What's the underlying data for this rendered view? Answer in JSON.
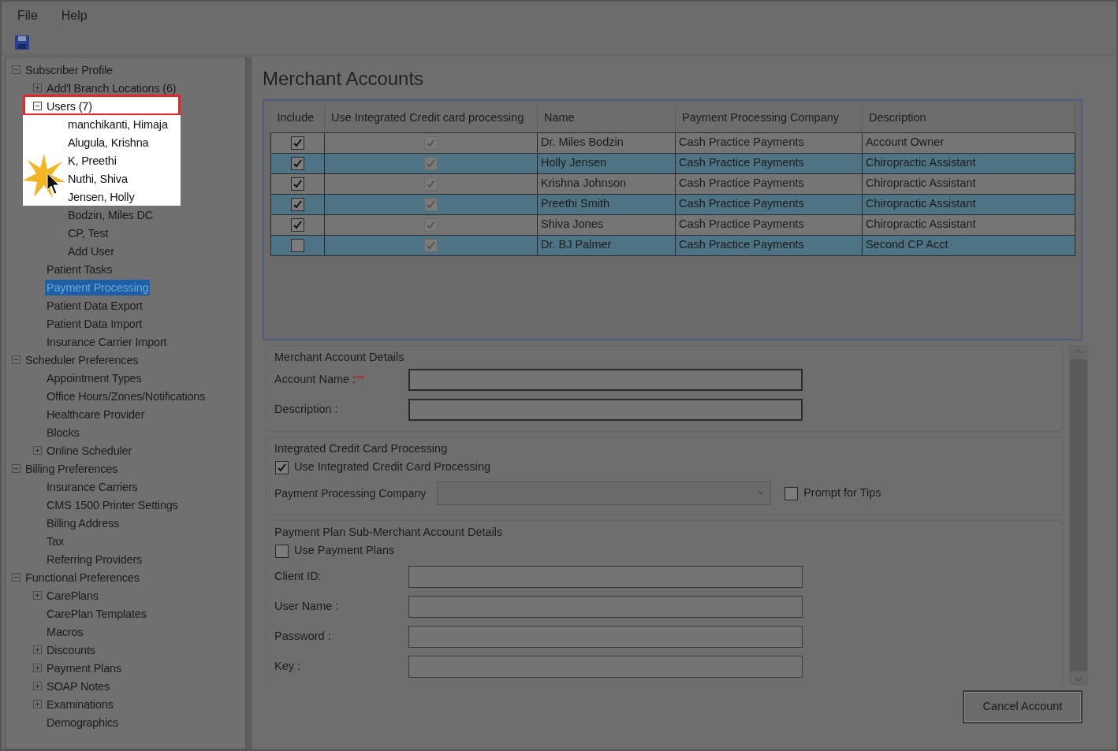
{
  "menu": [
    {
      "label": "File"
    },
    {
      "label": "Help"
    }
  ],
  "toolbar": [
    {
      "kind": "save"
    }
  ],
  "tree": [
    {
      "label": "Subscriber Profile",
      "expanded": true,
      "children": [
        {
          "label": "Add'l Branch Locations (6)",
          "expanded": false
        },
        {
          "label": "Users (7)",
          "expanded": true,
          "spotlight": true,
          "outlined": true,
          "children": [
            {
              "label": "manchikanti, Himaja",
              "spotlight": true
            },
            {
              "label": "Alugula, Krishna",
              "spotlight": true
            },
            {
              "label": "K, Preethi",
              "spotlight": true
            },
            {
              "label": "Nuthi, Shiva",
              "spotlight": true
            },
            {
              "label": "Jensen, Holly",
              "spotlight": true
            },
            {
              "label": "Bodzin, Miles DC"
            },
            {
              "label": "CP, Test"
            },
            {
              "label": "Add User"
            }
          ]
        },
        {
          "label": "Patient Tasks"
        },
        {
          "label": "Payment Processing",
          "selected": true
        },
        {
          "label": "Patient Data Export"
        },
        {
          "label": "Patient Data Import"
        },
        {
          "label": "Insurance Carrier Import"
        }
      ]
    },
    {
      "label": "Scheduler Preferences",
      "expanded": true,
      "children": [
        {
          "label": "Appointment Types"
        },
        {
          "label": "Office Hours/Zones/Notifications"
        },
        {
          "label": "Healthcare Provider"
        },
        {
          "label": "Blocks"
        },
        {
          "label": "Online Scheduler",
          "expanded": false
        }
      ]
    },
    {
      "label": "Billing Preferences",
      "expanded": true,
      "children": [
        {
          "label": "Insurance Carriers"
        },
        {
          "label": "CMS 1500 Printer Settings"
        },
        {
          "label": "Billing Address"
        },
        {
          "label": "Tax"
        },
        {
          "label": "Referring Providers"
        }
      ]
    },
    {
      "label": "Functional Preferences",
      "expanded": true,
      "children": [
        {
          "label": "CarePlans",
          "expanded": false
        },
        {
          "label": "CarePlan Templates"
        },
        {
          "label": "Macros"
        },
        {
          "label": "Discounts",
          "expanded": false
        },
        {
          "label": "Payment Plans",
          "expanded": false
        },
        {
          "label": "SOAP Notes",
          "expanded": false
        },
        {
          "label": "Examinations",
          "expanded": false
        },
        {
          "label": "Demographics"
        }
      ]
    }
  ],
  "title": "Merchant Accounts",
  "table": {
    "columns": [
      "Include",
      "Use Integrated Credit card processing",
      "Name",
      "Payment Processing Company",
      "Description"
    ],
    "rows": [
      {
        "include": true,
        "integrated": true,
        "name": "Dr. Miles Bodzin",
        "company": "Cash Practice Payments",
        "description": "Account Owner"
      },
      {
        "include": true,
        "integrated": true,
        "name": "Holly Jensen",
        "company": "Cash Practice Payments",
        "description": "Chiropractic Assistant"
      },
      {
        "include": true,
        "integrated": true,
        "name": "Krishna Johnson",
        "company": "Cash Practice Payments",
        "description": "Chiropractic Assistant"
      },
      {
        "include": true,
        "integrated": true,
        "name": "Preethi Smith",
        "company": "Cash Practice Payments",
        "description": "Chiropractic Assistant"
      },
      {
        "include": true,
        "integrated": true,
        "name": "Shiva Jones",
        "company": "Cash Practice Payments",
        "description": "Chiropractic Assistant"
      },
      {
        "include": false,
        "integrated": true,
        "name": "Dr. BJ Palmer",
        "company": "Cash Practice Payments",
        "description": "Second CP Acct"
      }
    ]
  },
  "groups": [
    {
      "title": "Merchant Account Details",
      "items": [
        {
          "kind": "field",
          "label": "Account Name :",
          "required": "**"
        },
        {
          "kind": "field",
          "label": "Description :"
        }
      ]
    },
    {
      "title": "Integrated Credit Card Processing",
      "items": [
        {
          "kind": "checkbox",
          "label": "Use Integrated Credit Card Processing",
          "checked": true
        },
        {
          "kind": "select",
          "label": "Payment Processing Company",
          "side_checkbox": {
            "label": "Prompt for Tips",
            "checked": false
          }
        }
      ]
    },
    {
      "title": "Payment Plan Sub-Merchant Account Details",
      "items": [
        {
          "kind": "checkbox",
          "label": "Use Payment Plans",
          "checked": false
        },
        {
          "kind": "field",
          "label": "Client ID:"
        },
        {
          "kind": "field",
          "label": "User Name :"
        },
        {
          "kind": "field",
          "label": "Password :"
        },
        {
          "kind": "field",
          "label": "Key :"
        }
      ]
    }
  ],
  "button": "Cancel Account"
}
